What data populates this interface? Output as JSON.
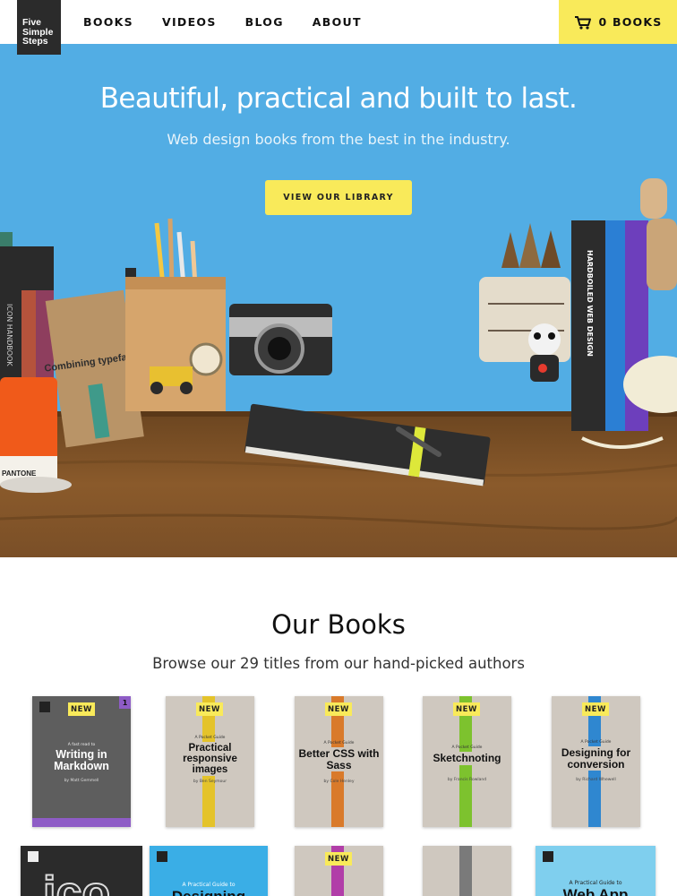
{
  "logo": {
    "line1": "Five",
    "line2": "Simple",
    "line3": "Steps"
  },
  "nav": {
    "items": [
      "BOOKS",
      "VIDEOS",
      "BLOG",
      "ABOUT"
    ]
  },
  "cart": {
    "label": "0 BOOKS",
    "icon": "shopping-cart-icon"
  },
  "hero": {
    "title": "Beautiful, practical and built to last.",
    "subtitle": "Web design books from the best in the industry.",
    "button": "VIEW OUR LIBRARY",
    "props": {
      "combining_typefaces": "Combining typefaces",
      "icon_handbook": "ICON HANDBOOK",
      "hardboiled": "HARDBOILED WEB DESIGN",
      "pantone": "PANTONE"
    }
  },
  "books_section": {
    "title": "Our Books",
    "subtitle": "Browse our 29 titles from our hand-picked authors"
  },
  "books": [
    {
      "pre": "A fast read to",
      "title": "Writing in Markdown",
      "byline": "by Matt Gemmell",
      "badge": "NEW",
      "number": "1"
    },
    {
      "pre": "A Pocket Guide",
      "title": "Practical responsive images",
      "byline": "by Ben Seymour",
      "badge": "NEW"
    },
    {
      "pre": "A Pocket Guide",
      "title": "Better CSS with Sass",
      "byline": "by Cole Henley",
      "badge": "NEW"
    },
    {
      "pre": "A Pocket Guide",
      "title": "Sketchnoting",
      "byline": "by Francis Rowland",
      "badge": "NEW"
    },
    {
      "pre": "A Pocket Guide",
      "title": "Designing for conversion",
      "byline": "by Richard Whewell",
      "badge": "NEW"
    }
  ],
  "books_row2": {
    "book2_pre": "A Practical Guide to",
    "book2_title": "Designing",
    "book3_badge": "NEW",
    "book5_pre": "A Practical Guide to",
    "book5_title": "Web App"
  },
  "colors": {
    "accent_yellow": "#f9ea5a",
    "hero_blue": "#52ade4",
    "header_dark": "#2b2b2b"
  }
}
